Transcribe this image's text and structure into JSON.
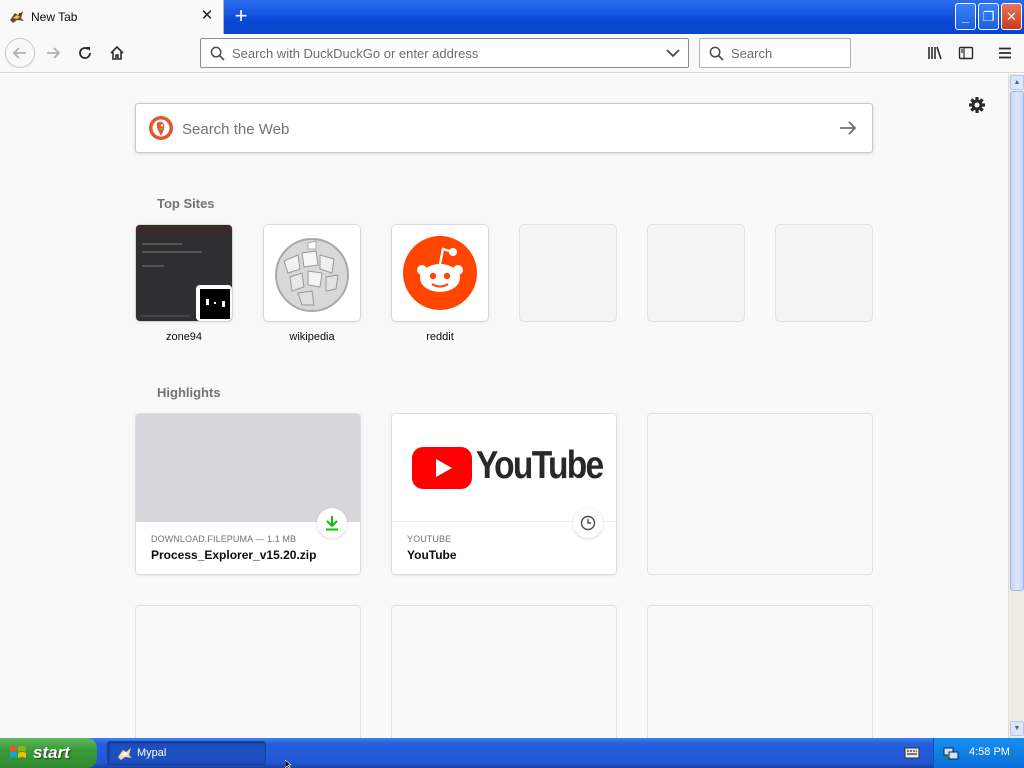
{
  "window": {
    "tab_title": "New Tab",
    "tab_close_glyph": "✕",
    "new_tab_glyph": "+",
    "controls": {
      "minimize": "_",
      "restore": "❐",
      "close": "✕"
    }
  },
  "navbar": {
    "url_placeholder": "Search with DuckDuckGo or enter address",
    "search_placeholder": "Search",
    "icons": [
      "back-icon",
      "forward-icon",
      "reload-icon",
      "home-icon",
      "library-icon",
      "sidebar-icon",
      "menu-icon"
    ]
  },
  "newtab": {
    "web_search_placeholder": "Search the Web",
    "top_sites_title": "Top Sites",
    "top_sites": [
      {
        "label": "zone94"
      },
      {
        "label": "wikipedia"
      },
      {
        "label": "reddit"
      },
      {
        "label": ""
      },
      {
        "label": ""
      },
      {
        "label": ""
      }
    ],
    "highlights_title": "Highlights",
    "highlights": [
      {
        "source": "DOWNLOAD.FILEPUMA — 1.1 MB",
        "title": "Process_Explorer_v15.20.zip",
        "badge": "download-icon"
      },
      {
        "source": "YOUTUBE",
        "title": "YouTube",
        "badge": "clock-icon",
        "logo_text": "YouTube"
      }
    ]
  },
  "taskbar": {
    "start_label": "start",
    "task_label": "Mypal",
    "clock": "4:58 PM"
  },
  "colors": {
    "titlebar_blue": "#0a48d6",
    "reddit_orange": "#ff4500",
    "youtube_red": "#ff0000",
    "download_green": "#12bc00",
    "start_green": "#3c9a3a",
    "taskbar_blue": "#245edb"
  }
}
